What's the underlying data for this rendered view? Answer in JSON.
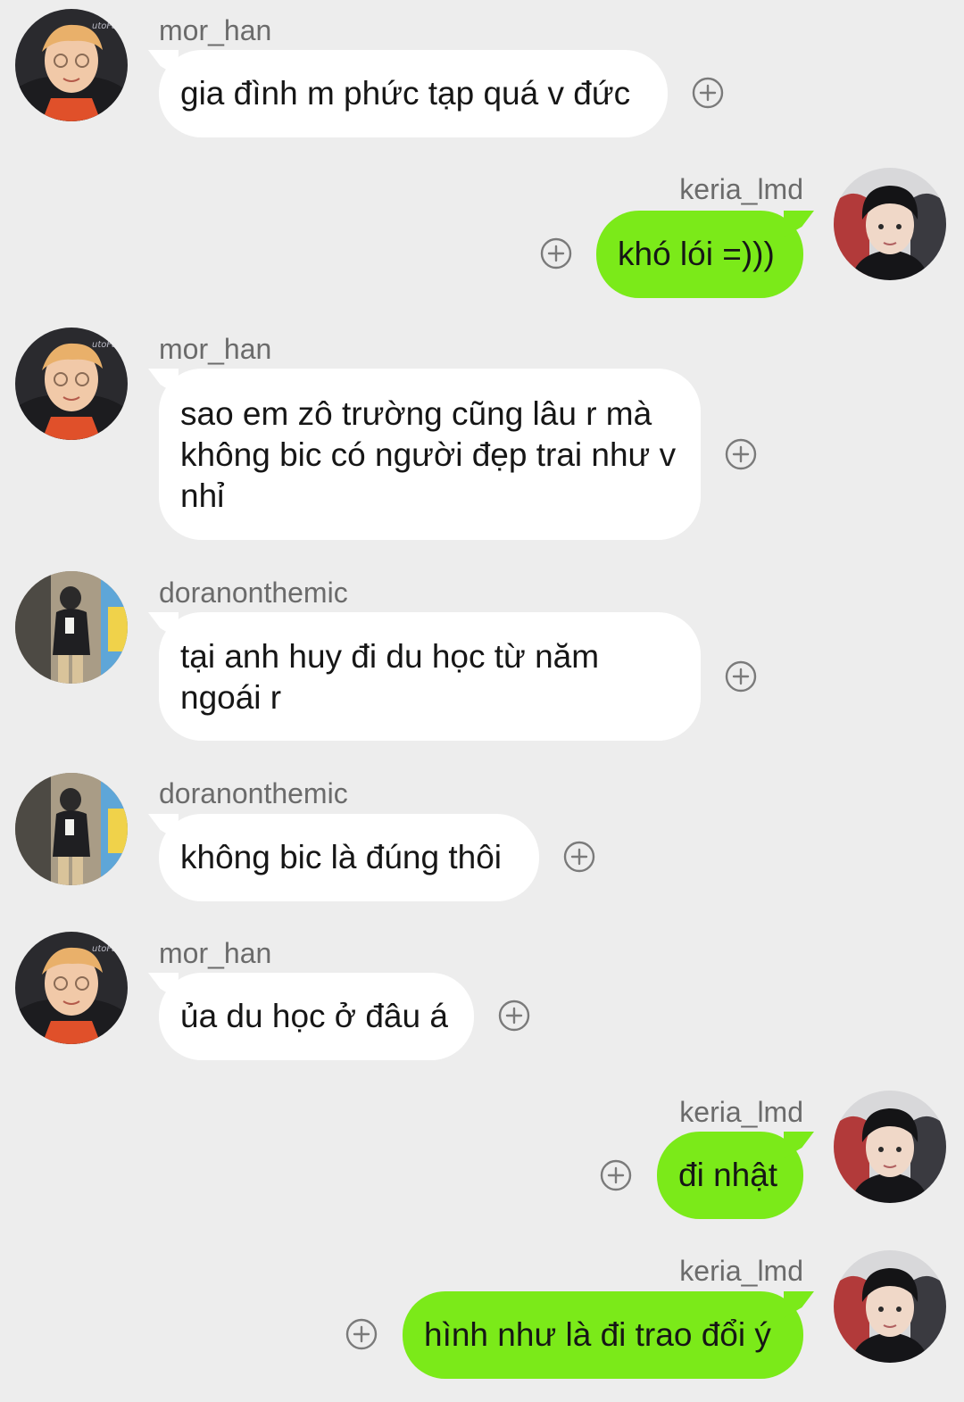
{
  "messages": [
    {
      "sender": "mor_han",
      "text": "gia đình m phức tạp quá v đức",
      "direction": "incoming",
      "avatar": "avatar-mor-han"
    },
    {
      "sender": "keria_lmd",
      "text": "khó lói =)))",
      "direction": "outgoing",
      "avatar": "avatar-keria-lmd"
    },
    {
      "sender": "mor_han",
      "text": "sao em zô trường cũng lâu r mà không bic có người đẹp trai như v nhỉ",
      "direction": "incoming",
      "avatar": "avatar-mor-han"
    },
    {
      "sender": "doranonthemic",
      "text": "tại anh huy đi du học từ năm ngoái r",
      "direction": "incoming",
      "avatar": "avatar-doranonthemic"
    },
    {
      "sender": "doranonthemic",
      "text": "không bic là đúng thôi",
      "direction": "incoming",
      "avatar": "avatar-doranonthemic"
    },
    {
      "sender": "mor_han",
      "text": "ủa du học ở đâu á",
      "direction": "incoming",
      "avatar": "avatar-mor-han"
    },
    {
      "sender": "keria_lmd",
      "text": "đi nhật",
      "direction": "outgoing",
      "avatar": "avatar-keria-lmd"
    },
    {
      "sender": "keria_lmd",
      "text": "hình như là đi trao đổi ý",
      "direction": "outgoing",
      "avatar": "avatar-keria-lmd"
    }
  ],
  "icons": {
    "reaction": "add-reaction-icon"
  },
  "colors": {
    "background": "#ededed",
    "incoming_bubble": "#ffffff",
    "outgoing_bubble": "#7bea19",
    "sender_name": "#6b6b6b",
    "reaction_icon": "#7a7a7a"
  }
}
